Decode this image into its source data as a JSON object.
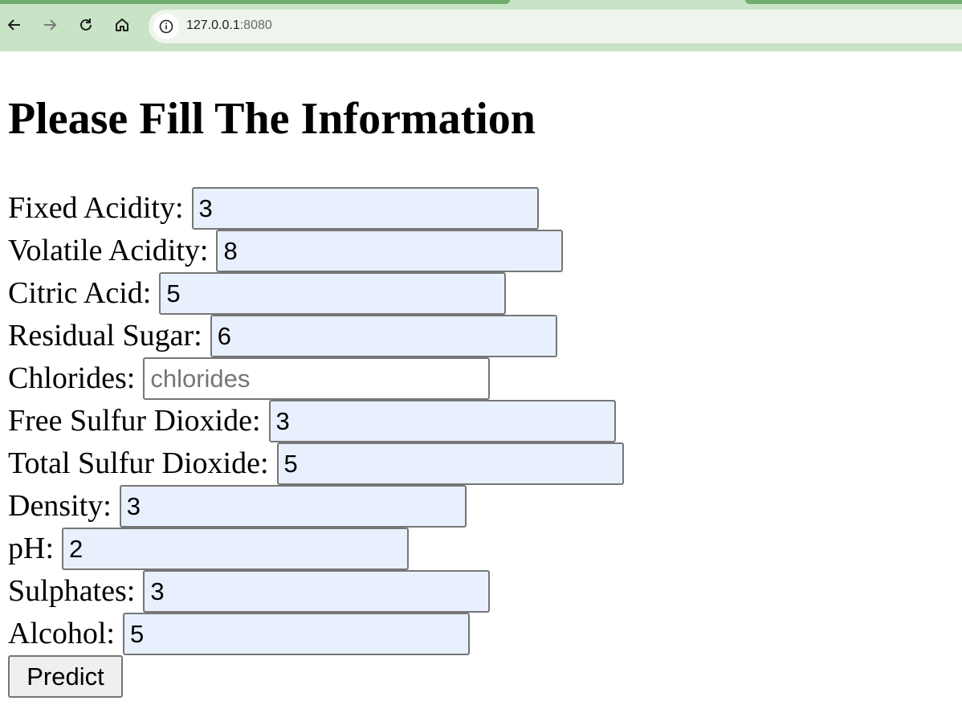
{
  "browser": {
    "url_host": "127.0.0.1",
    "url_port": ":8080",
    "icons": {
      "back": "back-arrow-icon",
      "forward": "forward-arrow-icon",
      "reload": "reload-icon",
      "home": "home-icon",
      "site_info": "info-icon"
    }
  },
  "page": {
    "title": "Please Fill The Information",
    "fields": [
      {
        "label": "Fixed Acidity:",
        "value": "3",
        "placeholder": ""
      },
      {
        "label": "Volatile Acidity:",
        "value": "8",
        "placeholder": ""
      },
      {
        "label": "Citric Acid:",
        "value": "5",
        "placeholder": ""
      },
      {
        "label": "Residual Sugar:",
        "value": "6",
        "placeholder": ""
      },
      {
        "label": "Chlorides:",
        "value": "",
        "placeholder": "chlorides"
      },
      {
        "label": "Free Sulfur Dioxide:",
        "value": "3",
        "placeholder": ""
      },
      {
        "label": "Total Sulfur Dioxide:",
        "value": "5",
        "placeholder": ""
      },
      {
        "label": "Density:",
        "value": "3",
        "placeholder": ""
      },
      {
        "label": "pH:",
        "value": "2",
        "placeholder": ""
      },
      {
        "label": "Sulphates:",
        "value": "3",
        "placeholder": ""
      },
      {
        "label": "Alcohol:",
        "value": "5",
        "placeholder": ""
      }
    ],
    "submit_label": "Predict"
  },
  "colors": {
    "chrome_bg": "#c8e3c6",
    "tab_accent": "#6fae6c",
    "autofill_bg": "#e8f0fe"
  }
}
